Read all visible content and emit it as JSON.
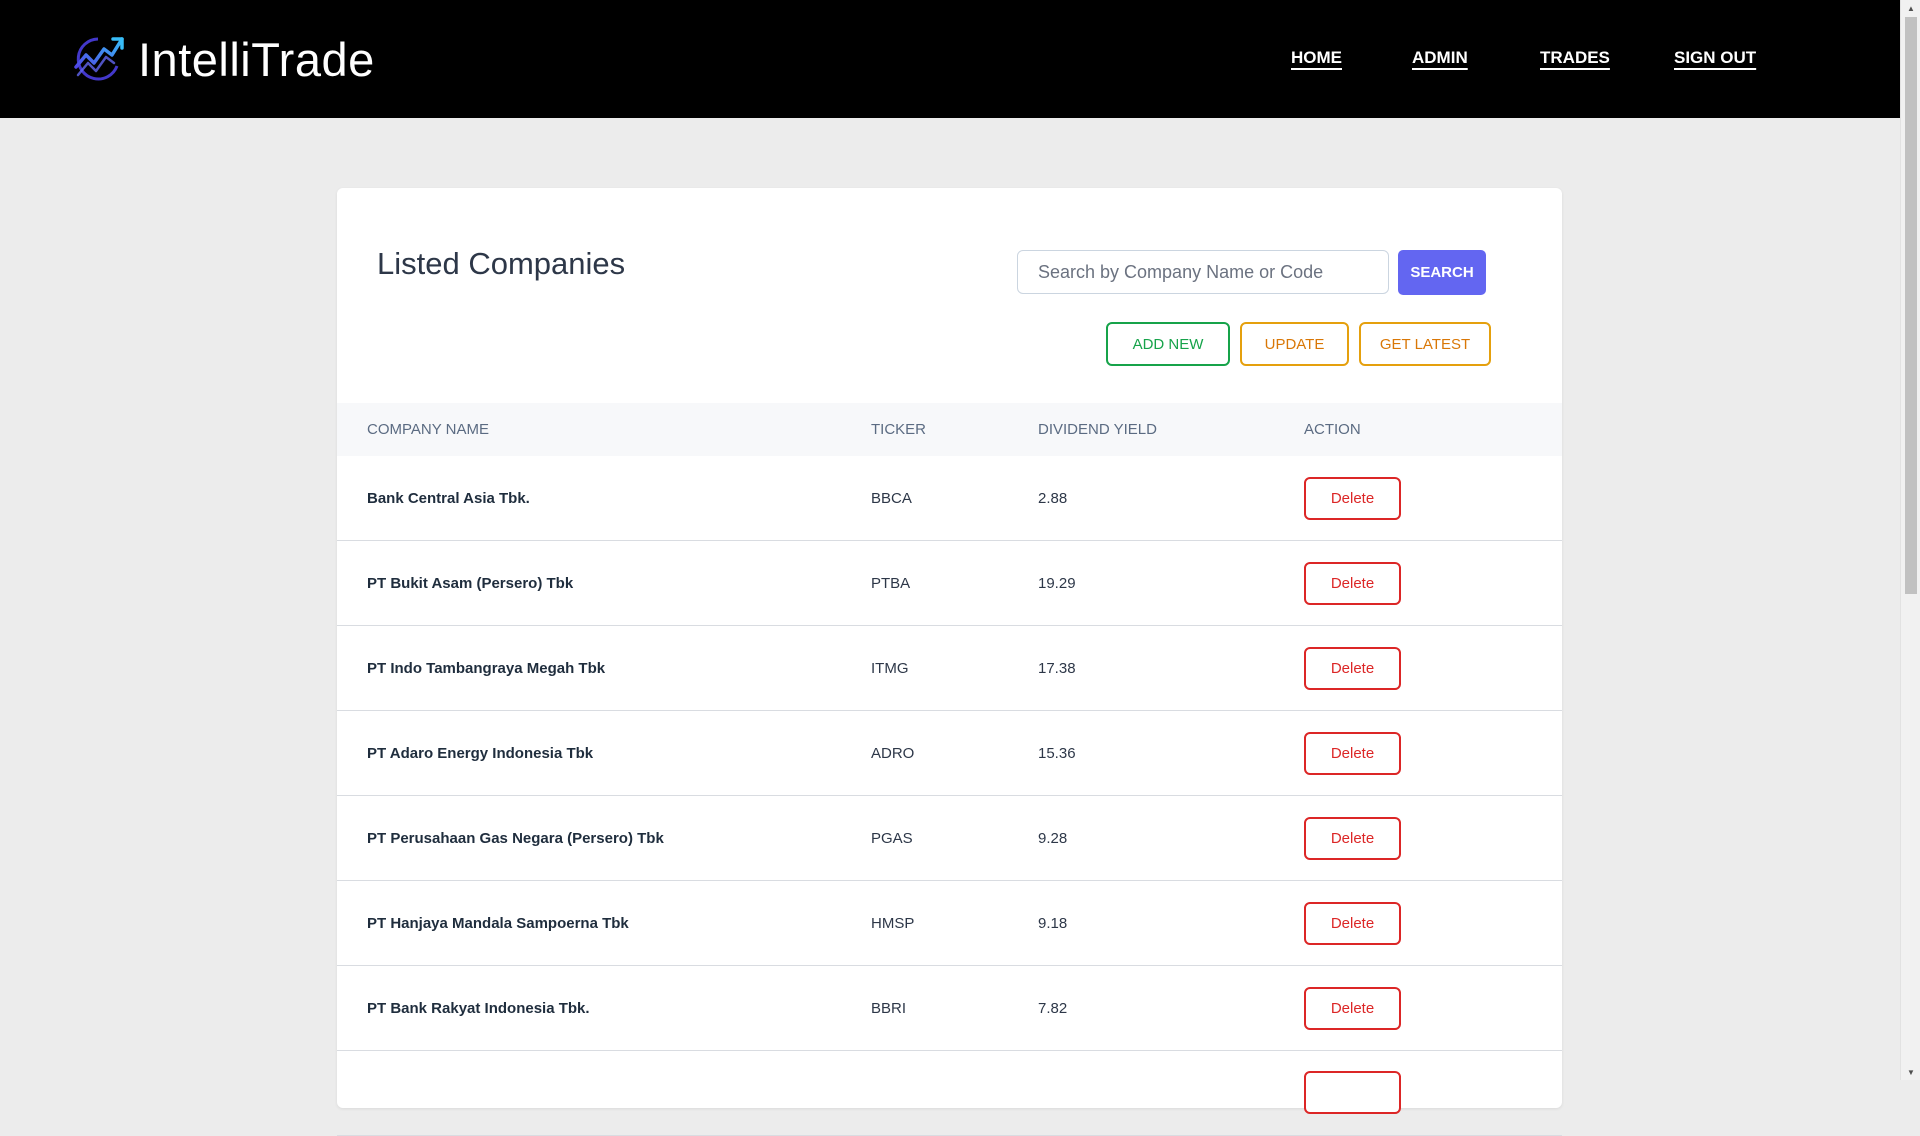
{
  "app": {
    "brand": "IntelliTrade"
  },
  "nav": {
    "items": [
      {
        "label": "HOME",
        "name": "nav-home"
      },
      {
        "label": "ADMIN",
        "name": "nav-admin"
      },
      {
        "label": "TRADES",
        "name": "nav-trades"
      },
      {
        "label": "SIGN OUT",
        "name": "nav-sign-out"
      }
    ]
  },
  "page": {
    "title": "Listed Companies"
  },
  "search": {
    "placeholder": "Search by Company Name or Code",
    "value": "",
    "button_label": "SEARCH"
  },
  "actions": {
    "add_new": "ADD NEW",
    "update": "UPDATE",
    "get_latest": "GET LATEST"
  },
  "table": {
    "headers": {
      "company": "COMPANY NAME",
      "ticker": "TICKER",
      "dividend": "DIVIDEND YIELD",
      "action": "ACTION"
    },
    "rows": [
      {
        "company": "Bank Central Asia Tbk.",
        "ticker": "BBCA",
        "dividend": "2.88",
        "action": "Delete"
      },
      {
        "company": "PT Bukit Asam (Persero) Tbk",
        "ticker": "PTBA",
        "dividend": "19.29",
        "action": "Delete"
      },
      {
        "company": "PT Indo Tambangraya Megah Tbk",
        "ticker": "ITMG",
        "dividend": "17.38",
        "action": "Delete"
      },
      {
        "company": "PT Adaro Energy Indonesia Tbk",
        "ticker": "ADRO",
        "dividend": "15.36",
        "action": "Delete"
      },
      {
        "company": "PT Perusahaan Gas Negara (Persero) Tbk",
        "ticker": "PGAS",
        "dividend": "9.28",
        "action": "Delete"
      },
      {
        "company": "PT Hanjaya Mandala Sampoerna Tbk",
        "ticker": "HMSP",
        "dividend": "9.18",
        "action": "Delete"
      },
      {
        "company": "PT Bank Rakyat Indonesia Tbk.",
        "ticker": "BBRI",
        "dividend": "7.82",
        "action": "Delete"
      },
      {
        "company": "",
        "ticker": "",
        "dividend": "",
        "action": ""
      }
    ]
  },
  "colors": {
    "navbar": "#000000",
    "primary": "#6366f1",
    "success": "#16a34a",
    "warning": "#d97706",
    "danger": "#dc2626",
    "background": "#ececec"
  },
  "icons": {
    "logo": "trending-up-chart-icon"
  }
}
